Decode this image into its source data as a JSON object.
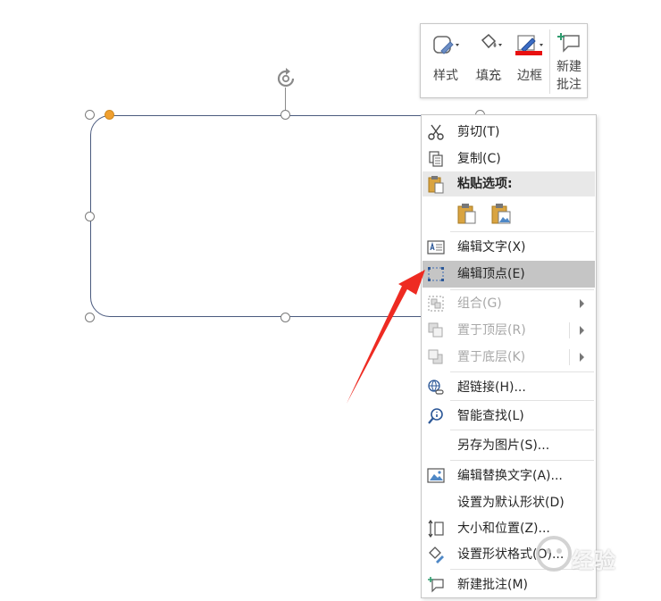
{
  "toolbar": {
    "style_label": "样式",
    "fill_label": "填充",
    "border_label": "边框",
    "new_comment_label": "新建\n批注"
  },
  "menu": {
    "cut": "剪切(T)",
    "copy": "复制(C)",
    "paste_options": "粘贴选项:",
    "edit_text": "编辑文字(X)",
    "edit_points": "编辑顶点(E)",
    "group": "组合(G)",
    "bring_to_front": "置于顶层(R)",
    "send_to_back": "置于底层(K)",
    "hyperlink": "超链接(H)...",
    "smart_lookup": "智能查找(L)",
    "save_as_picture": "另存为图片(S)...",
    "edit_alt_text": "编辑替换文字(A)...",
    "set_default_shape": "设置为默认形状(D)",
    "size_position": "大小和位置(Z)...",
    "format_shape": "设置形状格式(O)...",
    "new_comment": "新建批注(M)"
  },
  "watermark": {
    "text": "经验"
  },
  "colors": {
    "accent_red": "#e81010",
    "shape_outline": "#4a5a7e",
    "adjust_handle": "#f0a030",
    "menu_hover": "#c5c5c5",
    "arrow": "#ee2b22"
  },
  "icons": {
    "rotate": "rotate-icon",
    "style": "shape-style-icon",
    "fill": "paint-bucket-icon",
    "border": "pen-icon",
    "comment": "new-comment-icon"
  }
}
